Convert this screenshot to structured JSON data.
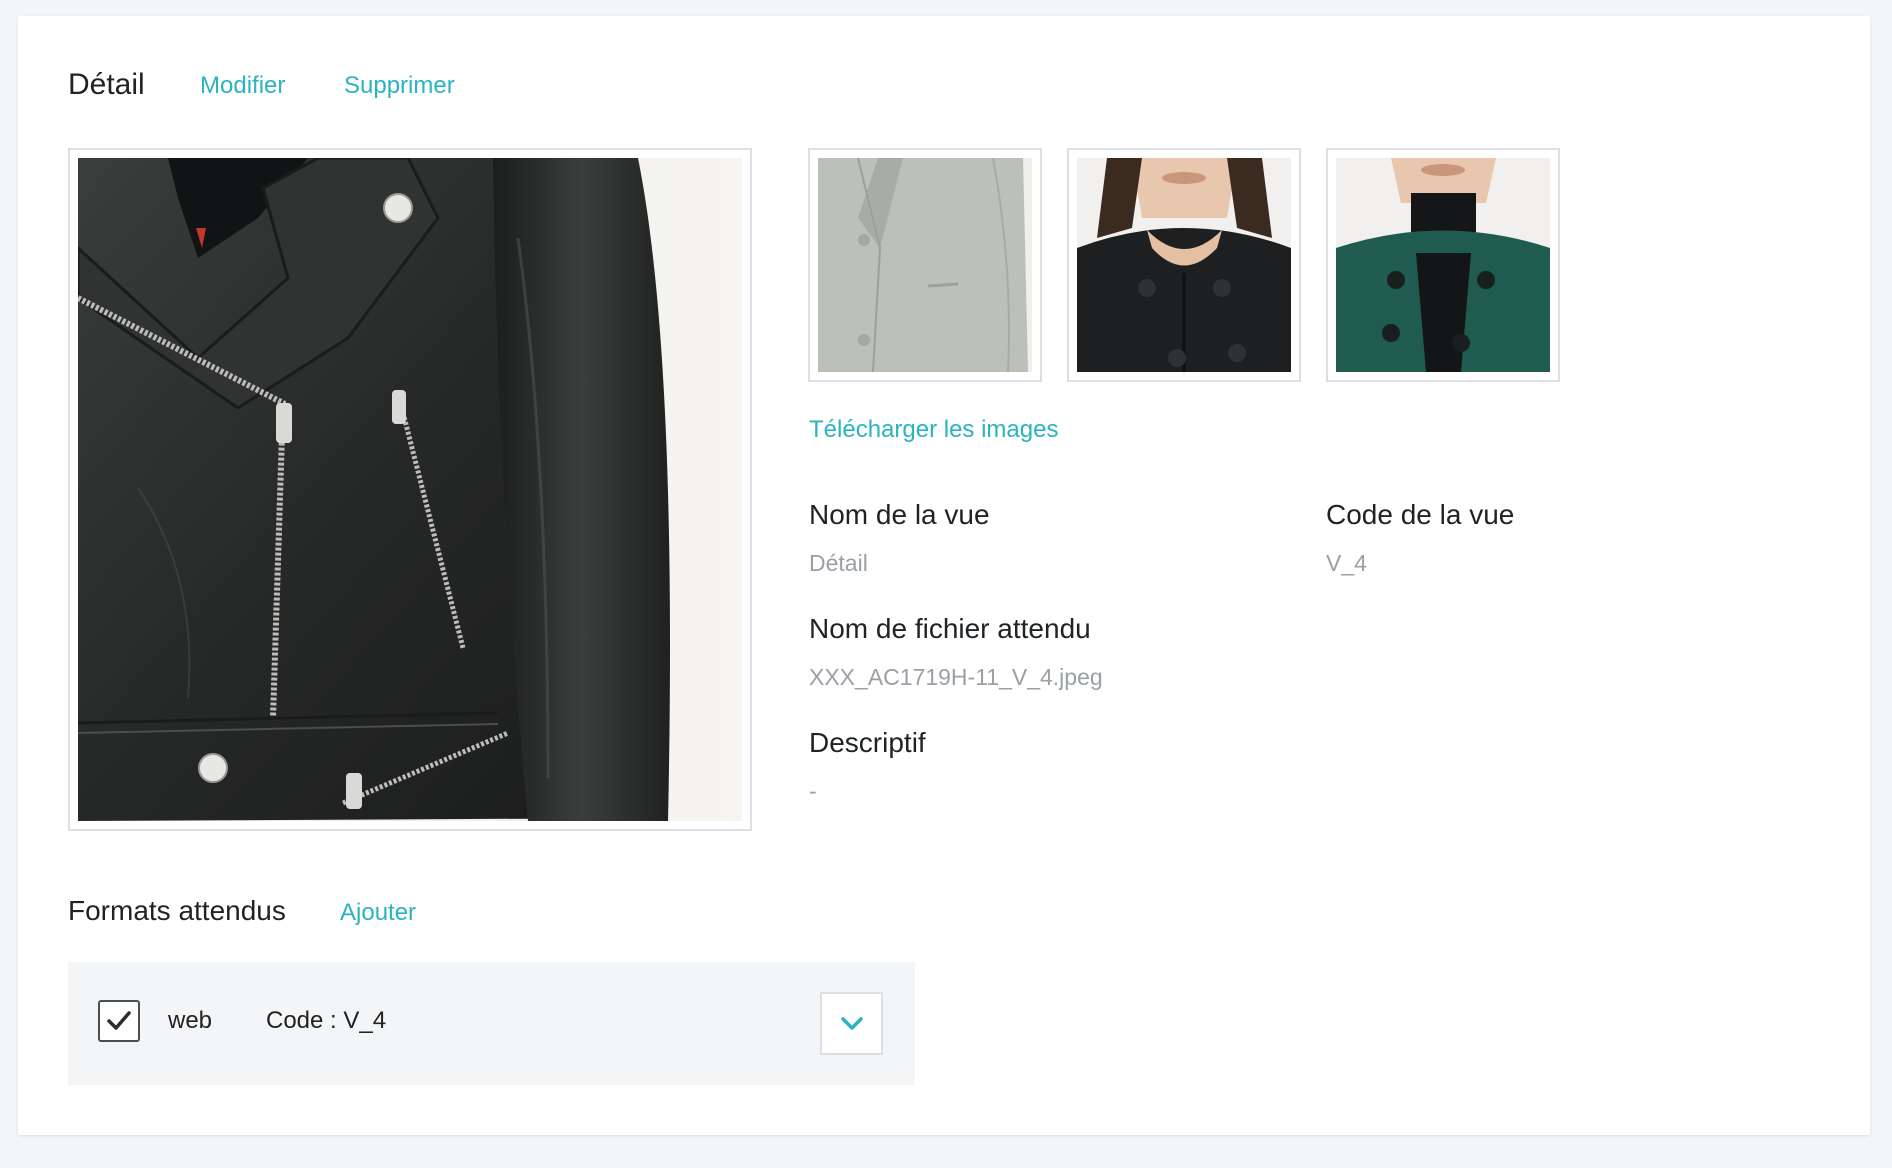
{
  "header": {
    "title": "Détail",
    "edit_label": "Modifier",
    "delete_label": "Supprimer"
  },
  "media": {
    "main_image": "black-leather-jacket-detail",
    "thumbnails": [
      "grey-wool-blazer",
      "black-round-neck-jacket",
      "green-round-neck-jacket"
    ],
    "download_label": "Télécharger les images"
  },
  "fields": {
    "view_name_label": "Nom de la vue",
    "view_name_value": "Détail",
    "view_code_label": "Code de la vue",
    "view_code_value": "V_4",
    "file_name_label": "Nom de fichier attendu",
    "file_name_value": "XXX_AC1719H-11_V_4.jpeg",
    "description_label": "Descriptif",
    "description_value": "-"
  },
  "formats": {
    "title": "Formats attendus",
    "add_label": "Ajouter",
    "items": [
      {
        "checked": true,
        "name": "web",
        "code_text": "Code : V_4"
      }
    ]
  },
  "colors": {
    "accent": "#2bb3bf",
    "background": "#f4f5f7",
    "card": "#ffffff",
    "muted_text": "#9aa0a6"
  },
  "icons": {
    "checkbox": "check-icon",
    "dropdown": "chevron-down-icon"
  }
}
